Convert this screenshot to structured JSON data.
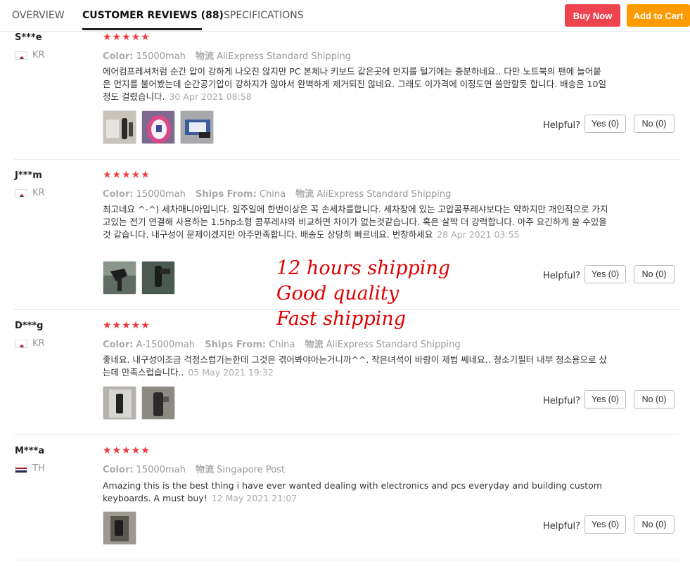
{
  "nav": {
    "tabs": [
      {
        "label": "OVERVIEW"
      },
      {
        "label": "CUSTOMER REVIEWS (88)"
      },
      {
        "label": "SPECIFICATIONS"
      }
    ],
    "buy_now": "Buy Now",
    "add_to_cart": "Add to Cart"
  },
  "colors": {
    "buy": "#ee4450",
    "cart": "#ff9a00",
    "stars": "#f0383e",
    "annotation": "#e00000"
  },
  "reviews": [
    {
      "user": "S***e",
      "country": "KR",
      "flag": "korea-flag-icon",
      "stars": "★★★★★",
      "rating": 5,
      "color_label": "Color:",
      "color_value": "15000mah",
      "ship_label": "物流",
      "ship_value": "AliExpress Standard Shipping",
      "text": "에어컴프레셔처럼 순간 압이 강하게 나오진 않지만 PC 본체나 키보드 같은곳에 먼지를 털기에는 충분하네요.. 다만 노트북의 팬에 늘어붙은 먼지를 불어봤는데 순간공기압이 강하지가 않아서 완벽하게 제거되진 않네요. 그래도 이가격에 이정도면 쓸만할듯 합니다. 배송은 10일정도 걸렸습니다.",
      "date": "30 Apr 2021 08:58",
      "helpful": "Helpful?",
      "yes": "Yes (0)",
      "no": "No (0)"
    },
    {
      "user": "J***m",
      "country": "KR",
      "flag": "korea-flag-icon",
      "stars": "★★★★★",
      "rating": 5,
      "color_label": "Color:",
      "color_value": "15000mah",
      "from_label": "Ships From:",
      "from_value": "China",
      "ship_label": "物流",
      "ship_value": "AliExpress Standard Shipping",
      "text": "최고네요 ^-^) 세차매니아입니다. 일주일에 한번이상은 꼭 손세차를합니다. 세차장에 있는 고압콤푸레샤보다는 약하지만 개인적으로 가지고있는 전기 연결해 사용하는 1.5hp소형 콤푸레샤와 비교하면 차이가 없는것같습니다. 혹은 살짝 더 강력합니다. 아주 요긴하게 쓸 수있을것 같습니다. 내구성이 문제이겠지만 아주만족합니다. 배송도 상당히 빠르네요. 번창하세요",
      "date": "28 Apr 2021 03:55",
      "helpful": "Helpful?",
      "yes": "Yes (0)",
      "no": "No (0)"
    },
    {
      "user": "D***g",
      "country": "KR",
      "flag": "korea-flag-icon",
      "stars": "★★★★★",
      "rating": 5,
      "color_label": "Color:",
      "color_value": "A-15000mah",
      "from_label": "Ships From:",
      "from_value": "China",
      "ship_label": "物流",
      "ship_value": "AliExpress Standard Shipping",
      "text": "좋네요. 내구성이조금 걱정스럽기는한데 그것은 겪어봐야아는거니까^^. 작은녀석이 바람이 제법 쎄네요.. 청소기필터 내부 청소용으로 샀는데 만족스럽습니다..",
      "date": "05 May 2021 19:32",
      "helpful": "Helpful?",
      "yes": "Yes (0)",
      "no": "No (0)"
    },
    {
      "user": "M***a",
      "country": "TH",
      "flag": "thailand-flag-icon",
      "stars": "★★★★★",
      "rating": 5,
      "color_label": "Color:",
      "color_value": "15000mah",
      "ship_label": "物流",
      "ship_value": "Singapore Post",
      "text": "Amazing this is the best thing i have ever wanted dealing with electronics and pcs everyday and building custom keyboards. A must buy!",
      "date": "12 May 2021 21:07",
      "helpful": "Helpful?",
      "yes": "Yes (0)",
      "no": "No (0)"
    }
  ],
  "annotation": {
    "line1": "12 hours shipping",
    "line2": "Good quality",
    "line3": "Fast shipping"
  }
}
